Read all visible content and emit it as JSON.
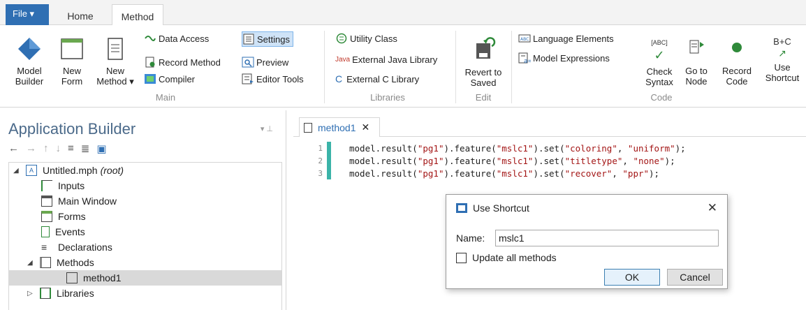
{
  "ribbon": {
    "file_tab": "File ▾",
    "tabs": [
      "Home",
      "Method"
    ],
    "active_tab": "Method",
    "groups": {
      "main": {
        "label": "Main",
        "model_builder": "Model\nBuilder",
        "new_form": "New\nForm",
        "new_method": "New\nMethod ▾",
        "data_access": "Data Access",
        "record_method": "Record Method",
        "compiler": "Compiler",
        "settings": "Settings",
        "preview": "Preview",
        "editor_tools": "Editor Tools"
      },
      "libraries": {
        "label": "Libraries",
        "utility_class": "Utility Class",
        "external_java": "External Java Library",
        "java_prefix": "Java",
        "external_c": "External C Library",
        "c_prefix": "C"
      },
      "edit": {
        "label": "Edit",
        "revert": "Revert to\nSaved"
      },
      "code": {
        "label": "Code",
        "language_elements": "Language Elements",
        "model_expressions": "Model Expressions",
        "check_syntax": "Check\nSyntax",
        "abc_tag": "[ABC]",
        "go_to_node": "Go to\nNode",
        "record_code": "Record\nCode",
        "use_shortcut": "Use\nShortcut",
        "bc_tag": "B+C"
      }
    }
  },
  "app_builder": {
    "title": "Application Builder",
    "tree": [
      {
        "label": "Untitled.mph",
        "suffix": "(root)",
        "depth": 0,
        "expanded": true
      },
      {
        "label": "Inputs",
        "depth": 1
      },
      {
        "label": "Main Window",
        "depth": 1
      },
      {
        "label": "Forms",
        "depth": 1
      },
      {
        "label": "Events",
        "depth": 1
      },
      {
        "label": "Declarations",
        "depth": 1
      },
      {
        "label": "Methods",
        "depth": 1,
        "expanded": true
      },
      {
        "label": "method1",
        "depth": 2,
        "selected": true
      },
      {
        "label": "Libraries",
        "depth": 1,
        "expanded": false
      }
    ]
  },
  "editor": {
    "tab_label": "method1",
    "tab_close": "✕",
    "lines": [
      {
        "n": "1",
        "prefix": "model.result(",
        "a": "\"pg1\"",
        "mid1": ").feature(",
        "b": "\"mslc1\"",
        "mid2": ").set(",
        "c": "\"coloring\"",
        "sep": ", ",
        "d": "\"uniform\"",
        "end": ");"
      },
      {
        "n": "2",
        "prefix": "model.result(",
        "a": "\"pg1\"",
        "mid1": ").feature(",
        "b": "\"mslc1\"",
        "mid2": ").set(",
        "c": "\"titletype\"",
        "sep": ", ",
        "d": "\"none\"",
        "end": ");"
      },
      {
        "n": "3",
        "prefix": "model.result(",
        "a": "\"pg1\"",
        "mid1": ").feature(",
        "b": "\"mslc1\"",
        "mid2": ").set(",
        "c": "\"recover\"",
        "sep": ", ",
        "d": "\"ppr\"",
        "end": ");"
      }
    ]
  },
  "dialog": {
    "title": "Use Shortcut",
    "close": "✕",
    "name_label": "Name:",
    "name_value": "mslc1",
    "update_all": "Update all methods",
    "ok": "OK",
    "cancel": "Cancel"
  },
  "colors": {
    "accent": "#2f6fb3",
    "code_string": "#a31515",
    "line_marker": "#3bb3a8",
    "panel_title": "#4b6a8a"
  }
}
